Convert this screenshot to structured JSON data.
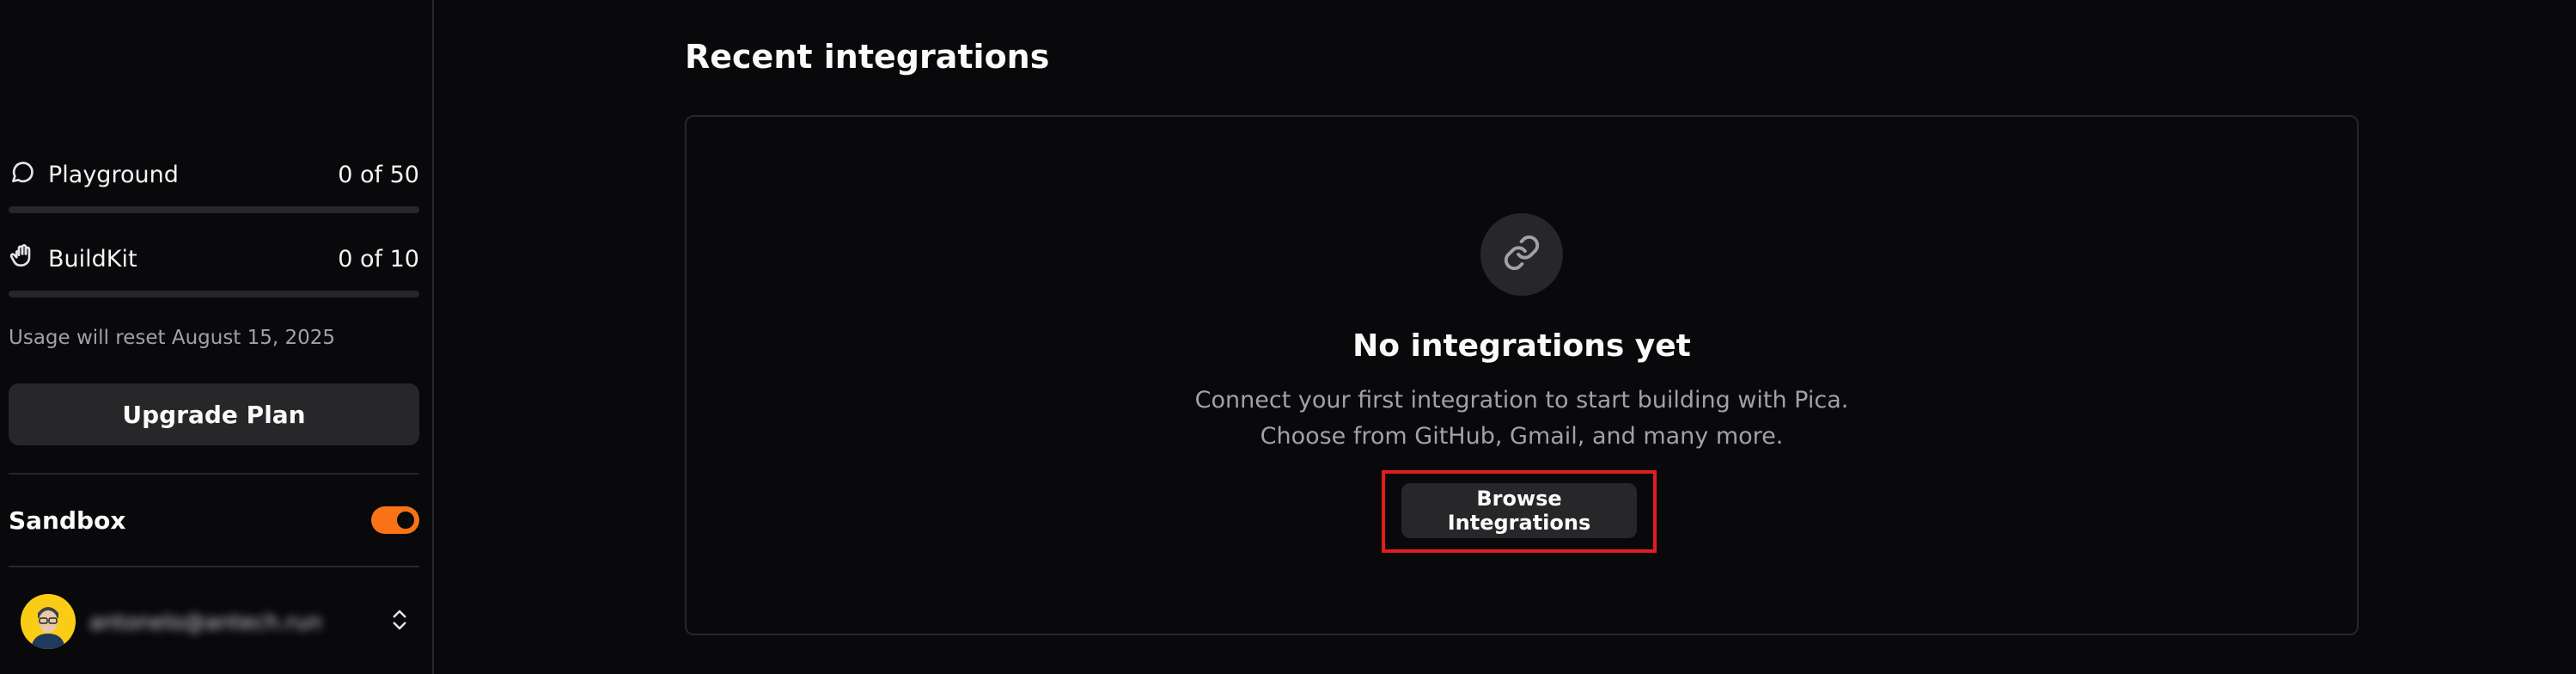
{
  "sidebar": {
    "usage": [
      {
        "label": "Playground",
        "count": "0 of 50",
        "icon": "chat-bubble-icon",
        "progress": 0
      },
      {
        "label": "BuildKit",
        "count": "0 of 10",
        "icon": "hand-pointer-icon",
        "progress": 0
      }
    ],
    "reset_text": "Usage will reset August 15, 2025",
    "upgrade_label": "Upgrade Plan",
    "sandbox_label": "Sandbox",
    "sandbox_enabled": true,
    "user_email": "antonelo@antech.run"
  },
  "main": {
    "title": "Recent integrations",
    "empty_state": {
      "icon": "link-icon",
      "title": "No integrations yet",
      "line1": "Connect your first integration to start building with Pica.",
      "line2": "Choose from GitHub, Gmail, and many more.",
      "button_label": "Browse Integrations"
    }
  },
  "colors": {
    "accent": "#f97316",
    "background": "#09090b",
    "surface": "#27272a",
    "highlight": "#e11d1d"
  }
}
